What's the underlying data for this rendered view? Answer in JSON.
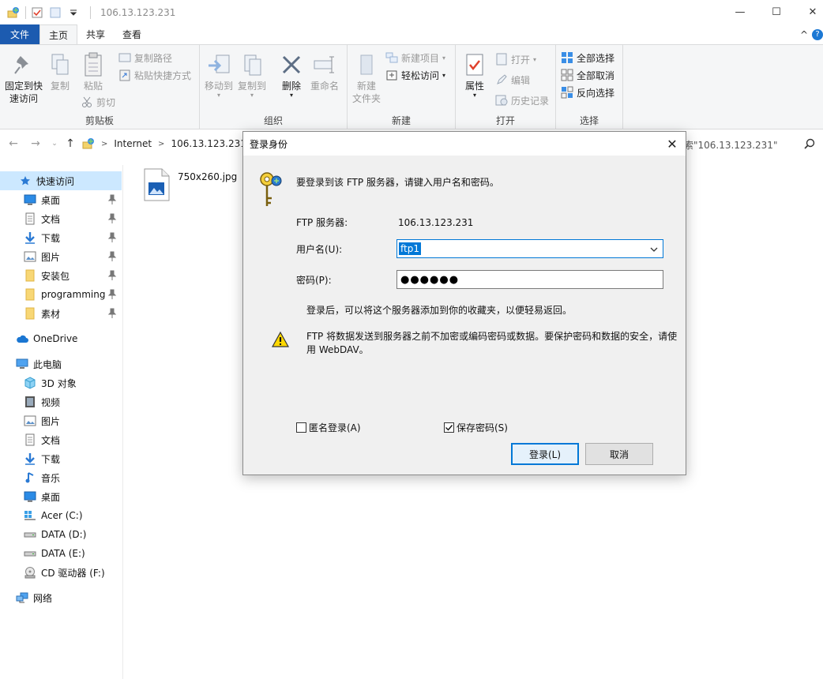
{
  "window": {
    "title": "106.13.123.231",
    "minimize": "—",
    "maximize": "☐",
    "close": "✕"
  },
  "ribbon_tabs": {
    "file": "文件",
    "home": "主页",
    "share": "共享",
    "view": "查看",
    "collapse": "^",
    "help": "?"
  },
  "ribbon": {
    "clipboard": {
      "label": "剪贴板",
      "pin_line1": "固定到快",
      "pin_line2": "速访问",
      "copy": "复制",
      "paste": "粘贴",
      "copy_path": "复制路径",
      "paste_shortcut": "粘贴快捷方式",
      "cut": "剪切"
    },
    "organize": {
      "label": "组织",
      "move_to": "移动到",
      "copy_to": "复制到",
      "delete": "删除",
      "rename": "重命名"
    },
    "new": {
      "label": "新建",
      "new_folder_line1": "新建",
      "new_folder_line2": "文件夹",
      "new_item": "新建项目",
      "easy_access": "轻松访问"
    },
    "open": {
      "label": "打开",
      "properties": "属性",
      "open": "打开",
      "edit": "编辑",
      "history": "历史记录"
    },
    "select": {
      "label": "选择",
      "select_all": "全部选择",
      "select_none": "全部取消",
      "invert": "反向选择"
    }
  },
  "address_bar": {
    "crumb1": "Internet",
    "crumb2": "106.13.123.231",
    "search_placeholder": "索\"106.13.123.231\""
  },
  "sidebar": {
    "quick_access": "快速访问",
    "qa_items": [
      "桌面",
      "文档",
      "下载",
      "图片",
      "安装包",
      "programming",
      "素材"
    ],
    "onedrive": "OneDrive",
    "this_pc": "此电脑",
    "pc_items": [
      "3D 对象",
      "视频",
      "图片",
      "文档",
      "下载",
      "音乐",
      "桌面",
      "Acer (C:)",
      "DATA (D:)",
      "DATA (E:)",
      "CD 驱动器 (F:)"
    ],
    "network": "网络"
  },
  "files": [
    {
      "name": "750x260.jpg"
    }
  ],
  "dialog": {
    "title": "登录身份",
    "intro": "要登录到该 FTP 服务器，请键入用户名和密码。",
    "server_label": "FTP 服务器:",
    "server_value": "106.13.123.231",
    "username_label": "用户名(U):",
    "username_value": "ftp1",
    "password_label": "密码(P):",
    "password_value": "●●●●●●",
    "hint": "登录后，可以将这个服务器添加到你的收藏夹，以便轻易返回。",
    "warning_line1": "FTP 将数据发送到服务器之前不加密或编码密码或数据。要保护密码和数据的安全，请使",
    "warning_line2": "用 WebDAV。",
    "anonymous_label": "匿名登录(A)",
    "anonymous_checked": false,
    "save_password_label": "保存密码(S)",
    "save_password_checked": true,
    "login_button": "登录(L)",
    "cancel_button": "取消"
  }
}
